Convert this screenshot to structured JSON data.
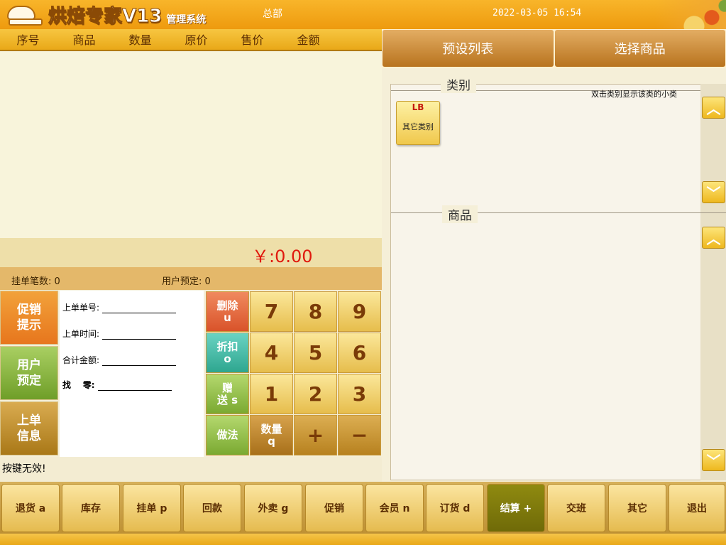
{
  "header": {
    "logo_text": "烘焙专家V13",
    "logo_sub": "管理系统",
    "store": "总部",
    "datetime": "2022-03-05 16:54"
  },
  "order_table": {
    "columns": [
      "序号",
      "商品",
      "数量",
      "原价",
      "售价",
      "金额"
    ]
  },
  "total": "￥:0.00",
  "stats": {
    "hung_orders": "挂单笔数: 0",
    "user_reservations": "用户预定: 0"
  },
  "side_buttons": {
    "promo": "促销\n提示",
    "reserve": "用户\n预定",
    "upinfo": "上单\n信息"
  },
  "info_panel": {
    "prev_order_no": "上单单号:",
    "prev_order_time": "上单时间:",
    "total_amount": "合计金额:",
    "change": "找    零:"
  },
  "keypad": {
    "delete": "删除\nu",
    "discount": "折扣\no",
    "gift": "赠\n送 s",
    "method": "做法",
    "quantity": "数量\nq",
    "digits": [
      "7",
      "8",
      "9",
      "4",
      "5",
      "6",
      "1",
      "2",
      "3"
    ],
    "plus": "+",
    "minus": "−"
  },
  "hint": "按键无效!",
  "right_tabs": [
    "预设列表",
    "选择商品"
  ],
  "category": {
    "legend": "类别",
    "hint": "双击类别显示该类的小类",
    "tiles": [
      {
        "code": "LB",
        "name": "其它类别"
      }
    ]
  },
  "product": {
    "legend": "商品"
  },
  "bottom_buttons": [
    {
      "label": "退货 a"
    },
    {
      "label": "库存"
    },
    {
      "label": "挂单 p"
    },
    {
      "label": "回款"
    },
    {
      "label": "外卖 g"
    },
    {
      "label": "促销"
    },
    {
      "label": "会员 n"
    },
    {
      "label": "订货 d"
    },
    {
      "label": "结算 +"
    },
    {
      "label": "交班"
    },
    {
      "label": "其它"
    },
    {
      "label": "退出"
    }
  ],
  "colors": {
    "header": "#f0a010",
    "total_text": "#e0190e",
    "active_button": "#7a760b"
  }
}
